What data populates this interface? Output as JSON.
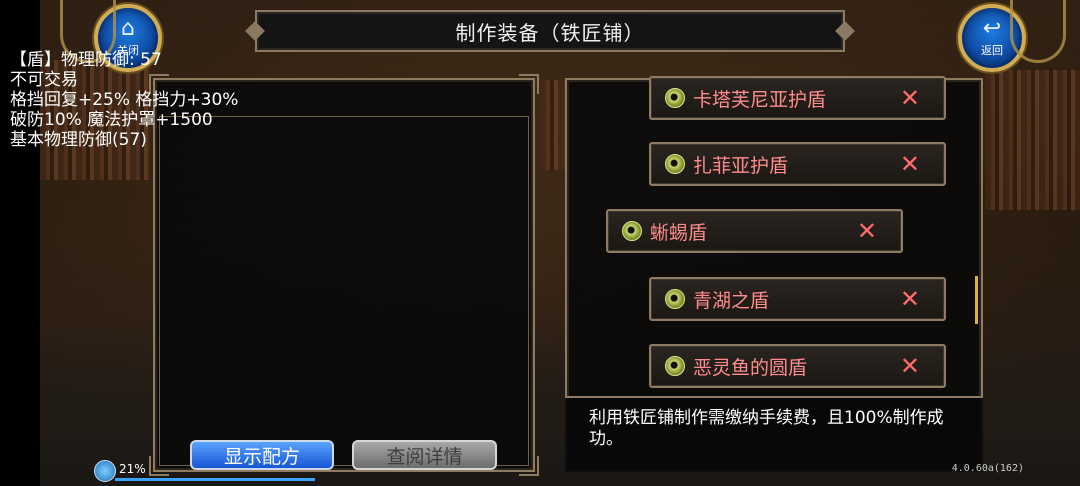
{
  "window": {
    "title": "制作装备（铁匠铺）"
  },
  "buttons": {
    "close_label": "关闭",
    "back_label": "返回",
    "show_recipe_label": "显示配方",
    "view_detail_label": "查阅详情"
  },
  "item_description": {
    "lines": "【盾】物理防御: 57\n不可交易\n格挡回复+25% 格挡力+30%\n破防10% 魔法护罩+1500\n基本物理防御(57)"
  },
  "recipe_list": {
    "items": [
      {
        "name": "卡塔芙尼亚护盾",
        "remove_icon": "close-x-icon"
      },
      {
        "name": "扎菲亚护盾",
        "remove_icon": "close-x-icon"
      },
      {
        "name": "蜥蜴盾",
        "remove_icon": "close-x-icon",
        "selected": true
      },
      {
        "name": "青湖之盾",
        "remove_icon": "close-x-icon"
      },
      {
        "name": "恶灵鱼的圆盾",
        "remove_icon": "close-x-icon"
      }
    ],
    "remove_symbol": "✕"
  },
  "notice": {
    "text": "利用铁匠铺制作需缴纳手续费，且100%制作成功。"
  },
  "status": {
    "percent": "21%",
    "version": "4.0.60a(162)"
  },
  "colors": {
    "item_name": "#ff8c8c",
    "accent_blue": "#1656d4",
    "scroll_thumb": "#e0b52c"
  }
}
